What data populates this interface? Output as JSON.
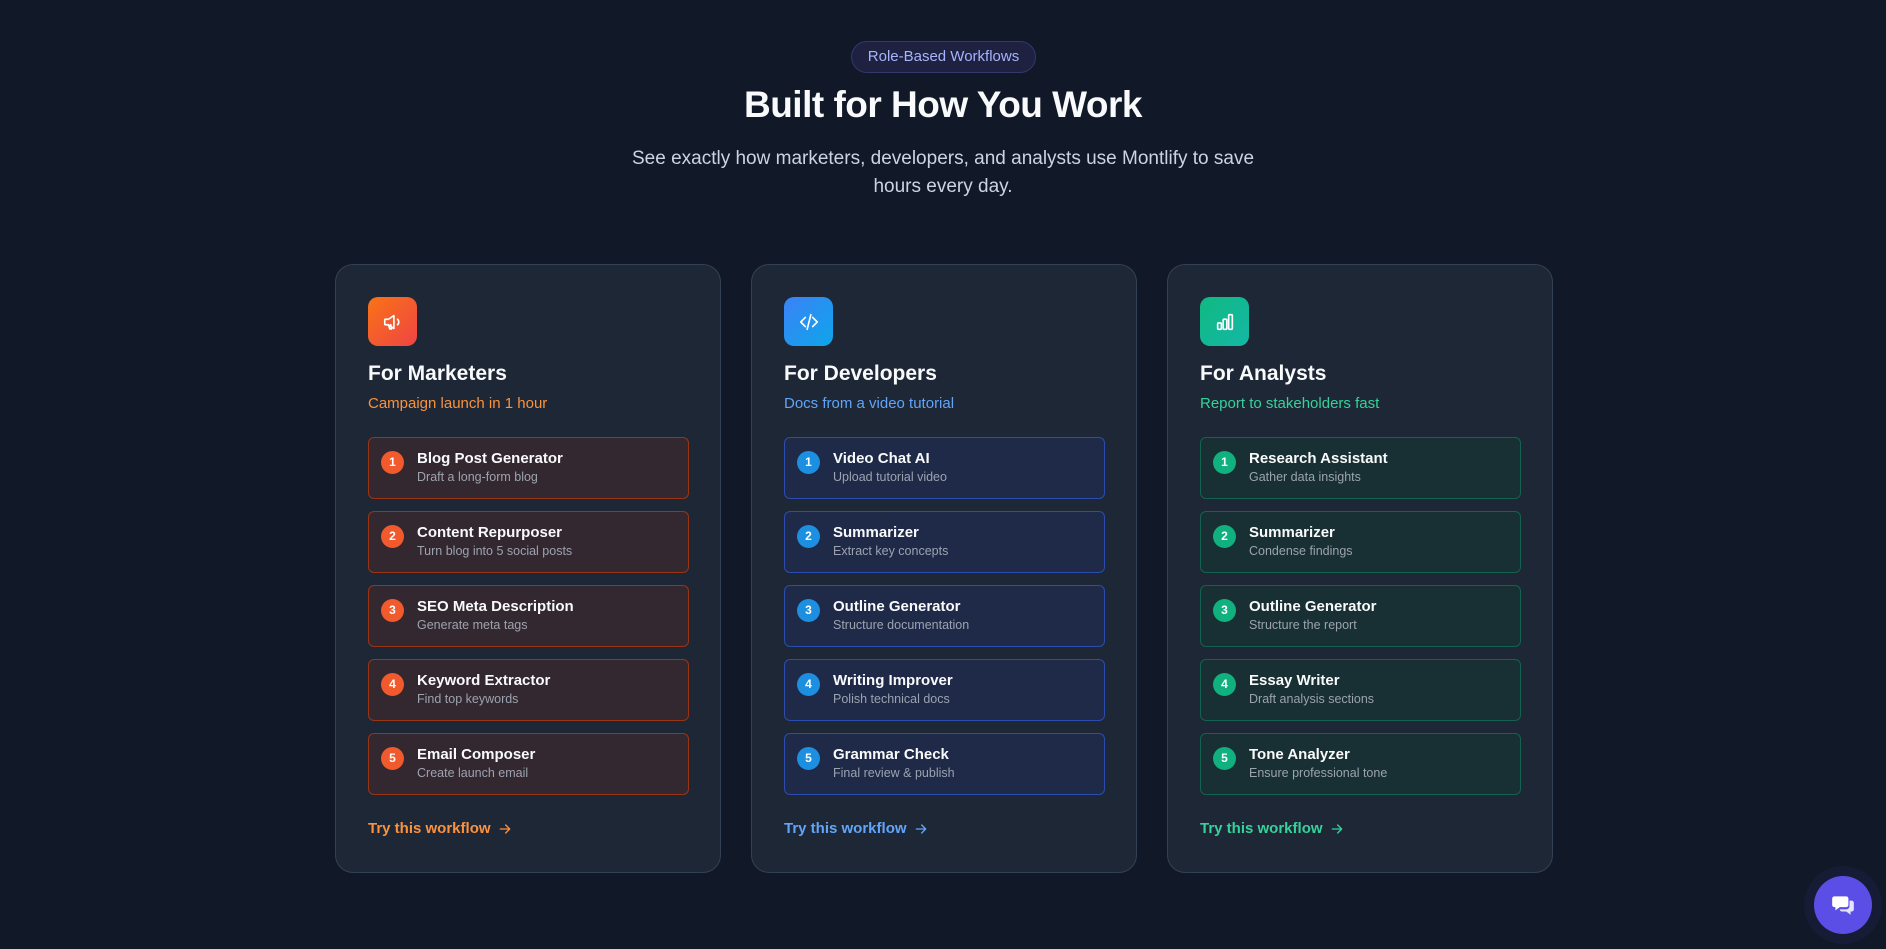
{
  "header": {
    "badge": "Role-Based Workflows",
    "title": "Built for How You Work",
    "subtitle": "See exactly how marketers, developers, and analysts use Montlify to save hours every day."
  },
  "colors": {
    "background": "#111827",
    "marketers_accent": "#fb923c",
    "developers_accent": "#60a5fa",
    "analysts_accent": "#34d399",
    "chat_button": "#5b4ee6"
  },
  "cards": [
    {
      "icon": "megaphone-icon",
      "title": "For Marketers",
      "subtitle": "Campaign launch in 1 hour",
      "steps": [
        {
          "num": "1",
          "title": "Blog Post Generator",
          "desc": "Draft a long-form blog"
        },
        {
          "num": "2",
          "title": "Content Repurposer",
          "desc": "Turn blog into 5 social posts"
        },
        {
          "num": "3",
          "title": "SEO Meta Description",
          "desc": "Generate meta tags"
        },
        {
          "num": "4",
          "title": "Keyword Extractor",
          "desc": "Find top keywords"
        },
        {
          "num": "5",
          "title": "Email Composer",
          "desc": "Create launch email"
        }
      ],
      "cta": "Try this workflow"
    },
    {
      "icon": "code-icon",
      "title": "For Developers",
      "subtitle": "Docs from a video tutorial",
      "steps": [
        {
          "num": "1",
          "title": "Video Chat AI",
          "desc": "Upload tutorial video"
        },
        {
          "num": "2",
          "title": "Summarizer",
          "desc": "Extract key concepts"
        },
        {
          "num": "3",
          "title": "Outline Generator",
          "desc": "Structure documentation"
        },
        {
          "num": "4",
          "title": "Writing Improver",
          "desc": "Polish technical docs"
        },
        {
          "num": "5",
          "title": "Grammar Check",
          "desc": "Final review & publish"
        }
      ],
      "cta": "Try this workflow"
    },
    {
      "icon": "bar-chart-icon",
      "title": "For Analysts",
      "subtitle": "Report to stakeholders fast",
      "steps": [
        {
          "num": "1",
          "title": "Research Assistant",
          "desc": "Gather data insights"
        },
        {
          "num": "2",
          "title": "Summarizer",
          "desc": "Condense findings"
        },
        {
          "num": "3",
          "title": "Outline Generator",
          "desc": "Structure the report"
        },
        {
          "num": "4",
          "title": "Essay Writer",
          "desc": "Draft analysis sections"
        },
        {
          "num": "5",
          "title": "Tone Analyzer",
          "desc": "Ensure professional tone"
        }
      ],
      "cta": "Try this workflow"
    }
  ],
  "chat": {
    "icon": "chat-bubbles-icon"
  }
}
